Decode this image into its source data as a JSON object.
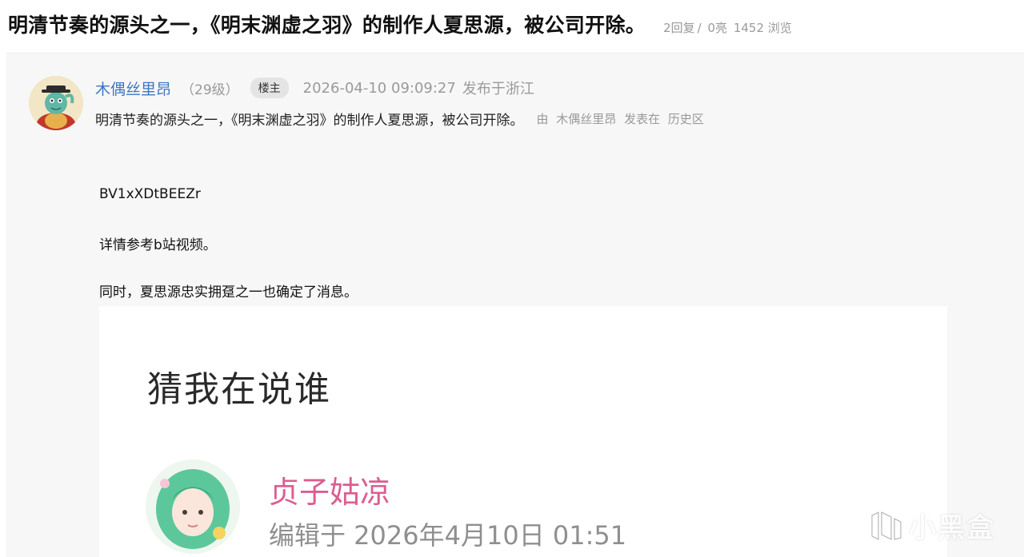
{
  "header": {
    "title": "明清节奏的源头之一，《明末渊虚之羽》的制作人夏思源，被公司开除。",
    "replies": "2回复",
    "separator": "/",
    "likes": "0亮",
    "views": "1452 浏览"
  },
  "post": {
    "author": {
      "name": "木偶丝里昂",
      "level": "（29级）",
      "badge": "楼主"
    },
    "time": "2026-04-10 09:09:27",
    "location": "发布于浙江",
    "subtitle": "明清节奏的源头之一，《明末渊虚之羽》的制作人夏思源，被公司开除。",
    "source": {
      "prefix": "由",
      "author": "木偶丝里昂",
      "posted_in": "发表在",
      "board": "历史区"
    },
    "body": [
      "BV1xXDtBEEZr",
      "详情参考b站视频。",
      "同时，夏思源忠实拥趸之一也确定了消息。"
    ],
    "embed": {
      "heading": "猜我在说谁",
      "name": "贞子姑凉",
      "date": "编辑于 2026年4月10日 01:51"
    }
  },
  "watermark": {
    "text": "小黑盒"
  },
  "colors": {
    "username": "#3f76c3",
    "embed_name": "#dc5e90",
    "muted": "#9a9a9a"
  }
}
